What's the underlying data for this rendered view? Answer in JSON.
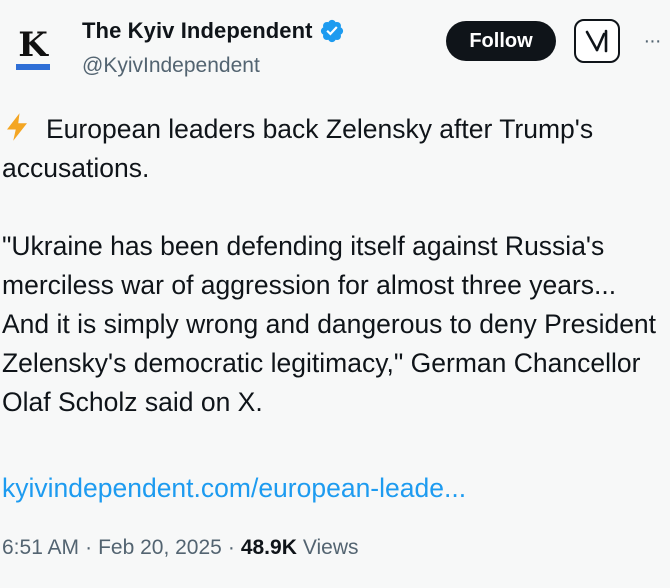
{
  "author": {
    "avatar_letter": "K",
    "name": "The Kyiv Independent",
    "handle": "@KyivIndependent",
    "verified": true
  },
  "actions": {
    "follow_label": "Follow",
    "grok_icon": "grok-icon",
    "more_icon": "more-icon",
    "more_glyph": "···"
  },
  "tweet": {
    "line1": "European leaders back Zelensky after Trump's accusations.",
    "quote": "\"Ukraine has been defending itself against Russia's merciless war of aggression for almost three years... And it is simply wrong and dangerous to deny President Zelensky's democratic legitimacy,\" German Chancellor Olaf Scholz said on X.",
    "link": "kyivindependent.com/european-leade..."
  },
  "meta": {
    "time": "6:51 AM",
    "separator": "·",
    "date": "Feb 20, 2025",
    "views_count": "48.9K",
    "views_label": "Views"
  },
  "colors": {
    "accent_link": "#1d9bf0",
    "verified_blue": "#1d9bf0",
    "follow_bg": "#0f1419",
    "muted": "#536471"
  }
}
